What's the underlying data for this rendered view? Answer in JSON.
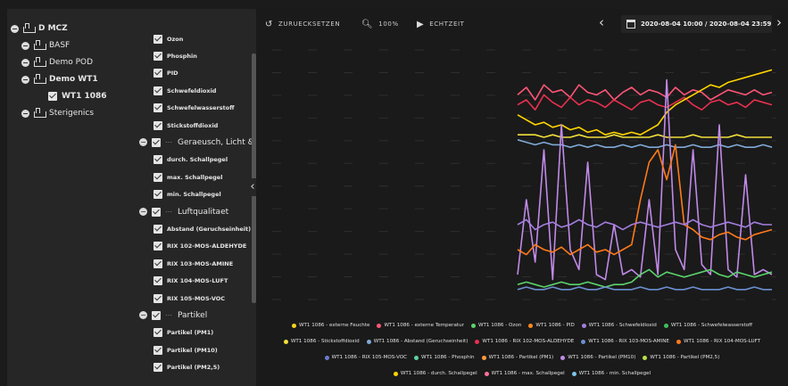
{
  "toolbar": {
    "reset_label": "ZURUECKSETZEN",
    "zoom_label": "100%",
    "realtime_label": "ECHTZEIT",
    "date_range": "2020-08-04 10:00 / 2020-08-04 23:59"
  },
  "tree": [
    {
      "label": "D MCZ",
      "bold": true
    },
    {
      "label": "BASF",
      "bold": false
    },
    {
      "label": "Demo POD",
      "bold": false
    },
    {
      "label": "Demo WT1",
      "bold": true
    },
    {
      "label": "WT1 1086",
      "bold": true
    },
    {
      "label": "Sterigenics",
      "bold": false
    }
  ],
  "sensors": [
    {
      "label": "Ozon"
    },
    {
      "label": "Phosphin"
    },
    {
      "label": "PID"
    },
    {
      "label": "Schwefeldioxid"
    },
    {
      "label": "Schwefelwasserstoff"
    },
    {
      "label": "Stickstoffdioxid"
    },
    {
      "label": "Geraeusch, Licht & Vib",
      "group": true
    },
    {
      "label": "durch. Schallpegel"
    },
    {
      "label": "max. Schallpegel"
    },
    {
      "label": "min. Schallpegel"
    },
    {
      "label": "Luftqualitaet",
      "group": true
    },
    {
      "label": "Abstand (Geruchseinheit)"
    },
    {
      "label": "RIX 102-MOS-ALDEHYDE"
    },
    {
      "label": "RIX 103-MOS-AMINE"
    },
    {
      "label": "RIX 104-MOS-LUFT"
    },
    {
      "label": "RIX 105-MOS-VOC"
    },
    {
      "label": "Partikel",
      "group": true
    },
    {
      "label": "Partikel (PM1)"
    },
    {
      "label": "Partikel (PM10)"
    },
    {
      "label": "Partikel (PM2,5)"
    }
  ],
  "legend": [
    [
      {
        "label": "WT1 1086 - externe Feuchte",
        "color": "#f4d21f"
      },
      {
        "label": "WT1 1086 - externe Temperatur",
        "color": "#ff5577"
      },
      {
        "label": "WT1 1086 - Ozon",
        "color": "#5bd36b"
      },
      {
        "label": "WT1 1086 - PID",
        "color": "#ff8a1d"
      },
      {
        "label": "WT1 1086 - Schwefeldioxid",
        "color": "#a37ee0"
      },
      {
        "label": "WT1 1086 - Schwefelwasserstoff",
        "color": "#3fbf5a"
      }
    ],
    [
      {
        "label": "WT1 1086 - Stickstoffdioxid",
        "color": "#f2e03a"
      },
      {
        "label": "WT1 1086 - Abstand (Geruchseinheit)",
        "color": "#7fa9d6"
      },
      {
        "label": "WT1 1086 - RIX 102-MOS-ALDEHYDE",
        "color": "#e8304e"
      },
      {
        "label": "WT1 1086 - RIX 103-MOS-AMINE",
        "color": "#6b8fcf"
      },
      {
        "label": "WT1 1086 - RIX 104-MOS-LUFT",
        "color": "#ff7a1a"
      }
    ],
    [
      {
        "label": "WT1 1086 - RIX 105-MOS-VOC",
        "color": "#6c7ad0"
      },
      {
        "label": "WT1 1086 - Phosphin",
        "color": "#5fd1a0"
      },
      {
        "label": "WT1 1086 - Partikel (PM1)",
        "color": "#ff9a3c"
      },
      {
        "label": "WT1 1086 - Partikel (PM10)",
        "color": "#c08ae8"
      },
      {
        "label": "WT1 1086 - Partikel (PM2,5)",
        "color": "#b8e04a"
      }
    ],
    [
      {
        "label": "WT1 1086 - durch. Schallpegel",
        "color": "#ffd400"
      },
      {
        "label": "WT1 1086 - max. Schallpegel",
        "color": "#ff6f9a"
      },
      {
        "label": "WT1 1086 - min. Schallpegel",
        "color": "#7cc6e8"
      }
    ]
  ],
  "chart_data": {
    "type": "line",
    "x": [
      0,
      1,
      2,
      3,
      4,
      5,
      6,
      7,
      8,
      9,
      10,
      11,
      12,
      13,
      14,
      15,
      16,
      17,
      18,
      19,
      20,
      21,
      22,
      23,
      24,
      25,
      26,
      27,
      28,
      29
    ],
    "series": [
      {
        "name": "WT1 1086 - externe Temperatur",
        "color": "#ff5577",
        "values": [
          82,
          85,
          80,
          86,
          83,
          84,
          81,
          86,
          83,
          82,
          84,
          80,
          83,
          85,
          82,
          84,
          83,
          81,
          85,
          82,
          84,
          83,
          80,
          82,
          84,
          83,
          82,
          84,
          82,
          83
        ]
      },
      {
        "name": "WT1 1086 - RIX 102-MOS-ALDEHYDE",
        "color": "#e8304e",
        "values": [
          78,
          80,
          76,
          82,
          79,
          77,
          81,
          78,
          80,
          79,
          77,
          80,
          78,
          76,
          79,
          80,
          78,
          77,
          79,
          81,
          78,
          76,
          79,
          80,
          78,
          79,
          77,
          80,
          79,
          78
        ]
      },
      {
        "name": "WT1 1086 - durch. Schallpegel",
        "color": "#ffd400",
        "values": [
          74,
          72,
          70,
          71,
          69,
          70,
          68,
          69,
          67,
          68,
          66,
          67,
          66,
          67,
          66,
          68,
          70,
          75,
          78,
          80,
          82,
          84,
          86,
          85,
          87,
          88,
          89,
          90,
          91,
          92
        ]
      },
      {
        "name": "WT1 1086 - Abstand (Geruchseinheit)",
        "color": "#7fa9d6",
        "values": [
          64,
          63,
          62,
          63,
          62,
          62,
          61,
          62,
          61,
          62,
          61,
          61,
          62,
          61,
          62,
          61,
          61,
          62,
          61,
          61,
          62,
          61,
          61,
          62,
          61,
          62,
          61,
          61,
          62,
          61
        ]
      },
      {
        "name": "WT1 1086 - Stickstoffdioxid",
        "color": "#f2e03a",
        "values": [
          66,
          66,
          66,
          65,
          66,
          65,
          65,
          66,
          65,
          65,
          65,
          66,
          65,
          65,
          65,
          65,
          66,
          65,
          65,
          65,
          66,
          65,
          65,
          65,
          65,
          66,
          65,
          65,
          65,
          65
        ]
      },
      {
        "name": "WT1 1086 - Partikel (PM10)",
        "color": "#c08ae8",
        "values": [
          10,
          40,
          15,
          60,
          8,
          70,
          20,
          12,
          55,
          10,
          8,
          30,
          10,
          12,
          9,
          40,
          10,
          88,
          20,
          12,
          60,
          14,
          10,
          70,
          12,
          9,
          50,
          10,
          12,
          10
        ]
      },
      {
        "name": "WT1 1086 - RIX 104-MOS-LUFT",
        "color": "#ff7a1a",
        "values": [
          20,
          18,
          22,
          20,
          19,
          21,
          18,
          20,
          22,
          19,
          20,
          18,
          20,
          22,
          40,
          55,
          60,
          48,
          62,
          30,
          28,
          25,
          24,
          26,
          27,
          25,
          24,
          26,
          27,
          28
        ]
      },
      {
        "name": "WT1 1086 - Ozon",
        "color": "#5bd36b",
        "values": [
          6,
          7,
          6,
          5,
          6,
          7,
          6,
          6,
          7,
          6,
          5,
          6,
          6,
          7,
          10,
          12,
          9,
          11,
          10,
          9,
          10,
          11,
          12,
          10,
          9,
          11,
          10,
          9,
          10,
          11
        ]
      },
      {
        "name": "WT1 1086 - RIX 103-MOS-AMINE",
        "color": "#6b8fcf",
        "values": [
          4,
          5,
          4,
          4,
          5,
          4,
          4,
          5,
          4,
          4,
          5,
          4,
          4,
          4,
          5,
          4,
          4,
          5,
          4,
          4,
          5,
          4,
          4,
          4,
          5,
          4,
          4,
          5,
          4,
          4
        ]
      },
      {
        "name": "WT1 1086 - Schwefeldioxid",
        "color": "#a37ee0",
        "values": [
          30,
          32,
          28,
          30,
          31,
          29,
          30,
          32,
          30,
          29,
          31,
          30,
          28,
          30,
          31,
          30,
          29,
          30,
          31,
          30,
          32,
          30,
          29,
          30,
          31,
          30,
          29,
          31,
          30,
          30
        ]
      }
    ],
    "ylim": [
      0,
      100
    ],
    "legend_position": "bottom"
  }
}
